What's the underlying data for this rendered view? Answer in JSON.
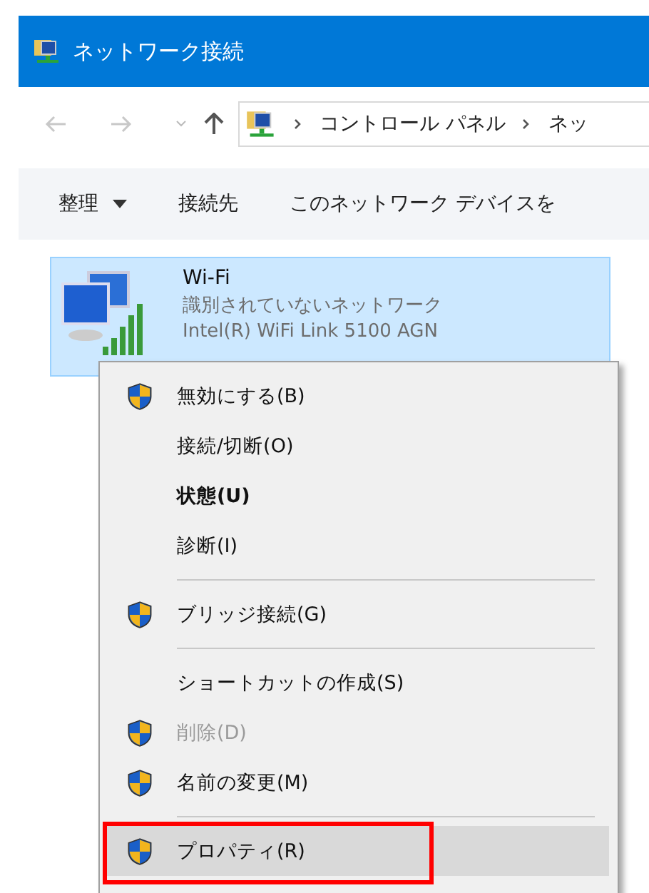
{
  "window": {
    "title": "ネットワーク接続"
  },
  "navigation": {
    "back_disabled": true,
    "forward_disabled": true,
    "breadcrumbs": [
      "コントロール パネル",
      "ネッ"
    ]
  },
  "toolbar": {
    "items": [
      {
        "label": "整理",
        "dropdown": true
      },
      {
        "label": "接続先",
        "dropdown": false
      },
      {
        "label": "このネットワーク デバイスを",
        "dropdown": false
      }
    ]
  },
  "connection": {
    "name": "Wi-Fi",
    "status": "識別されていないネットワーク",
    "adapter": "Intel(R) WiFi Link 5100 AGN",
    "selected": true
  },
  "context_menu": {
    "items": [
      {
        "kind": "item",
        "label": "無効にする(B)",
        "shield": true,
        "bold": false,
        "disabled": false,
        "selected": false,
        "annotated": false
      },
      {
        "kind": "item",
        "label": "接続/切断(O)",
        "shield": false,
        "bold": false,
        "disabled": false,
        "selected": false,
        "annotated": false
      },
      {
        "kind": "item",
        "label": "状態(U)",
        "shield": false,
        "bold": true,
        "disabled": false,
        "selected": false,
        "annotated": false
      },
      {
        "kind": "item",
        "label": "診断(I)",
        "shield": false,
        "bold": false,
        "disabled": false,
        "selected": false,
        "annotated": false
      },
      {
        "kind": "separator"
      },
      {
        "kind": "item",
        "label": "ブリッジ接続(G)",
        "shield": true,
        "bold": false,
        "disabled": false,
        "selected": false,
        "annotated": false
      },
      {
        "kind": "separator"
      },
      {
        "kind": "item",
        "label": "ショートカットの作成(S)",
        "shield": false,
        "bold": false,
        "disabled": false,
        "selected": false,
        "annotated": false
      },
      {
        "kind": "item",
        "label": "削除(D)",
        "shield": true,
        "bold": false,
        "disabled": true,
        "selected": false,
        "annotated": false
      },
      {
        "kind": "item",
        "label": "名前の変更(M)",
        "shield": true,
        "bold": false,
        "disabled": false,
        "selected": false,
        "annotated": false
      },
      {
        "kind": "separator"
      },
      {
        "kind": "item",
        "label": "プロパティ(R)",
        "shield": true,
        "bold": false,
        "disabled": false,
        "selected": true,
        "annotated": true
      }
    ]
  }
}
